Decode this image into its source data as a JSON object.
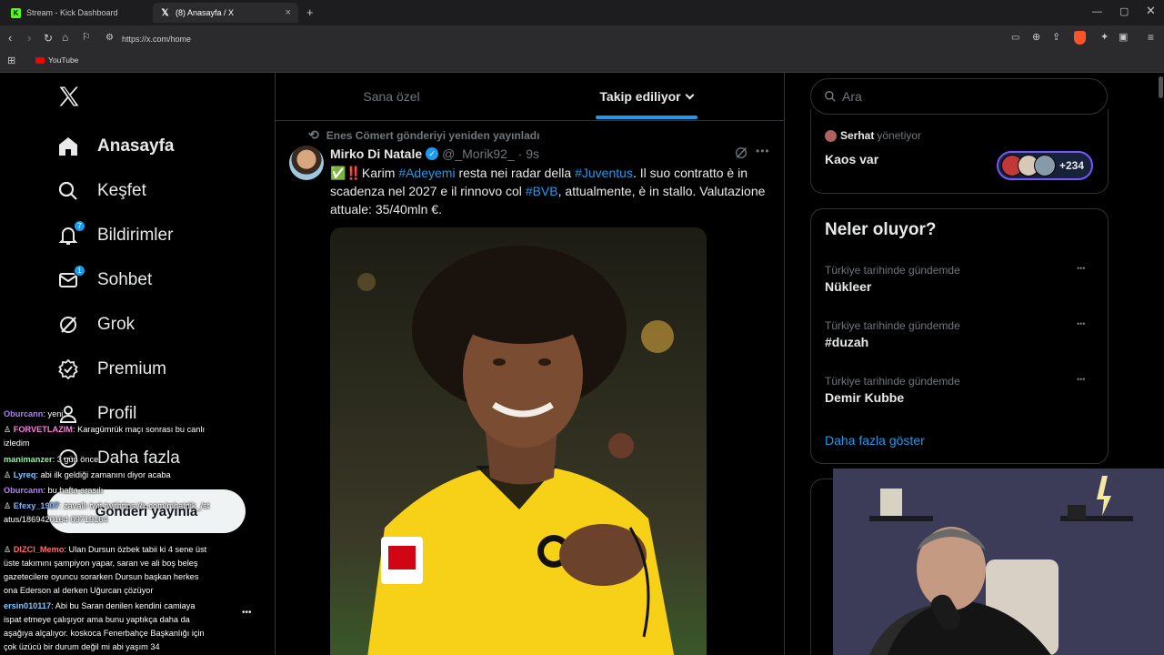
{
  "browser": {
    "tabs": [
      {
        "title": "Stream - Kick Dashboard",
        "icon": "kick-icon"
      },
      {
        "title": "(8) Anasayfa / X",
        "icon": "x-logo-icon"
      }
    ],
    "url": "https://x.com/home",
    "bookmarks": [
      {
        "label": "YouTube",
        "icon": "youtube-icon"
      }
    ]
  },
  "nav": {
    "items": [
      {
        "label": "Anasayfa",
        "icon": "home-icon",
        "badge": ""
      },
      {
        "label": "Keşfet",
        "icon": "search-icon",
        "badge": ""
      },
      {
        "label": "Bildirimler",
        "icon": "bell-icon",
        "badge": "7"
      },
      {
        "label": "Sohbet",
        "icon": "mail-icon",
        "badge": "1"
      },
      {
        "label": "Grok",
        "icon": "grok-icon",
        "badge": ""
      },
      {
        "label": "Premium",
        "icon": "premium-icon",
        "badge": ""
      },
      {
        "label": "Profil",
        "icon": "profile-icon",
        "badge": ""
      },
      {
        "label": "Daha fazla",
        "icon": "more-icon",
        "badge": ""
      }
    ],
    "post_button": "Gönderi yayınla",
    "more_dots": "•••"
  },
  "timeline": {
    "tabs": [
      {
        "label": "Sana özel",
        "active": false
      },
      {
        "label": "Takip ediliyor",
        "active": true
      }
    ],
    "repost_note": "Enes Cömert gönderiyi yeniden yayınladı",
    "post": {
      "author": "Mirko Di Natale",
      "handle": "@_Morik92_",
      "time": "· 9s",
      "text_prefix": "✅‼️Karim ",
      "tag1": "#Adeyemi",
      "text_mid1": " resta nei radar della ",
      "tag2": "#Juventus",
      "text_mid2": ". Il suo contratto è in scadenza nel 2027 e il rinnovo col ",
      "tag3": "#BVB",
      "text_end": ", attualmente, è in stallo. Valutazione attuale: 35/40mln €."
    }
  },
  "sidebar": {
    "search_placeholder": "Ara",
    "community": {
      "manager": "Serhat",
      "manager_suffix": "yönetiyor",
      "name": "Kaos var",
      "member_count": "+234"
    },
    "trends_title": "Neler oluyor?",
    "trends": [
      {
        "context": "Türkiye tarihinde gündemde",
        "name": "Nükleer"
      },
      {
        "context": "Türkiye tarihinde gündemde",
        "name": "#duzah"
      },
      {
        "context": "Türkiye tarihinde gündemde",
        "name": "Demir Kubbe"
      }
    ],
    "show_more": "Daha fazla göster"
  },
  "chat": [
    {
      "user": "Oburcann",
      "color": "#b57bff",
      "msg": ": yeni"
    },
    {
      "user": "FORVETLAZIM",
      "color": "#ff7be0",
      "msg": ": Karagümrük maçı sonrası bu canlı izledim"
    },
    {
      "user": "manimanzer",
      "color": "#7bff9e",
      "msg": ": 3 gün önce"
    },
    {
      "user": "Lyreq",
      "color": "#7bc8ff",
      "msg": ": abi ilk geldiği zamanını diyor acaba"
    },
    {
      "user": "Oburcann",
      "color": "#b57bff",
      "msg": ": bu hafta arasılı"
    },
    {
      "user": "Efexy_1907",
      "color": "#7bb4ff",
      "msg": ": zavallı twit twithttps://x.com/mhatdik_/status/1869420164 09719164"
    },
    {
      "user": "DIZCI_Memo",
      "color": "#ff6b6b",
      "msg": ": Ulan Dursun özbek tabii ki 4 sene üst üste takımını şampiyon yapar, saran ve ali boş beleş gazetecilere oyuncu sorarken Dursun başkan herkes ona Ederson al derken Uğurcan çözüyor"
    },
    {
      "user": "ersin010117",
      "color": "#7bc8ff",
      "msg": ": Abi bu Saran denilen kendini camiaya ispat etmeye çalışıyor ama bunu yaptıkça daha da aşağıya alçalıyor. koskoca Fenerbahçe Başkanlığı için çok üzücü bir durum değil mi abi yaşım 34"
    }
  ],
  "colors": {
    "accent": "#1d9bf0",
    "background": "#000000",
    "text": "#e7e9ea",
    "muted": "#71767b",
    "bvb_yellow": "#f7d117"
  }
}
